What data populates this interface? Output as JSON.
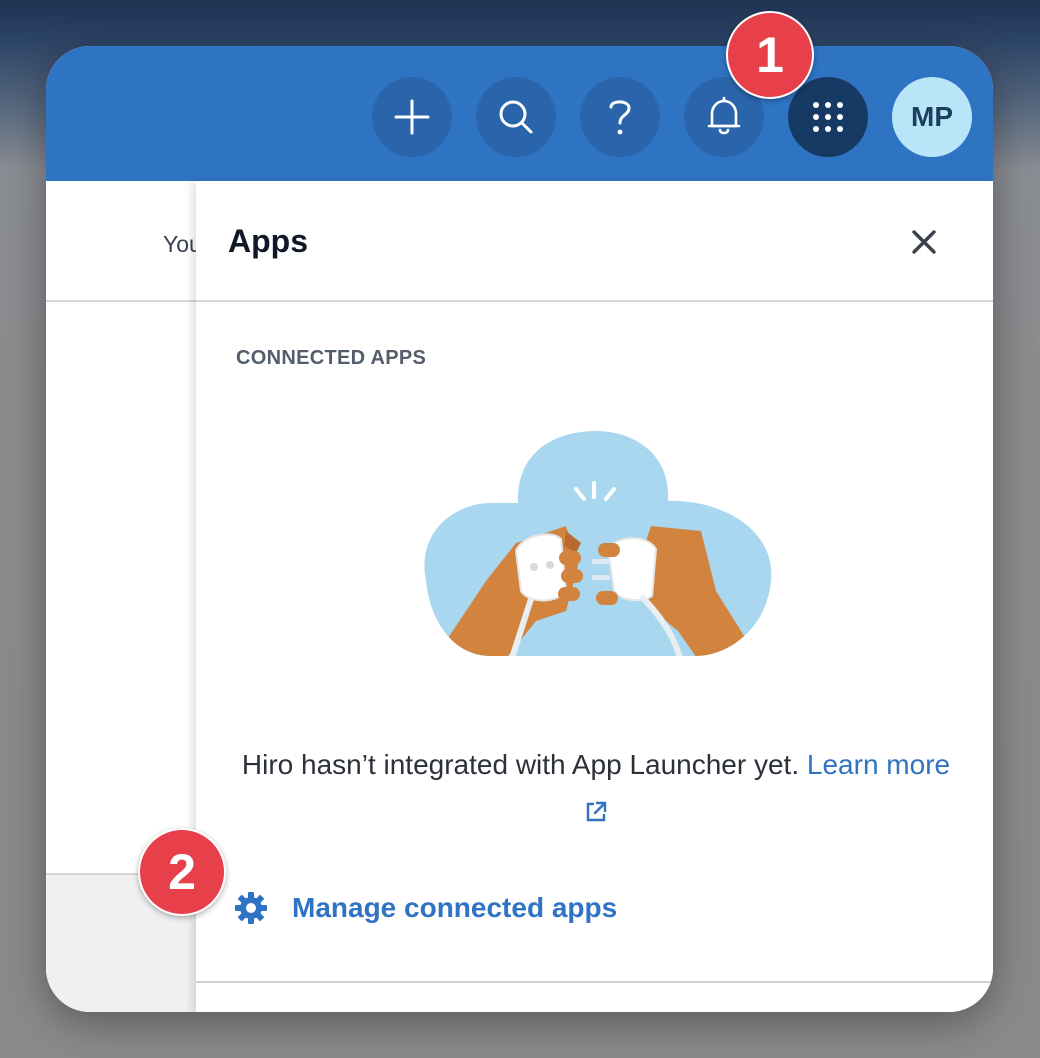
{
  "topbar": {
    "buttons": [
      {
        "icon": "plus-icon"
      },
      {
        "icon": "search-icon"
      },
      {
        "icon": "help-icon"
      },
      {
        "icon": "bell-icon"
      },
      {
        "icon": "app-launcher-grid-icon",
        "active": true
      }
    ],
    "avatar_initials": "MP"
  },
  "background_page": {
    "partial_text": "You"
  },
  "panel": {
    "title": "Apps",
    "section_label": "CONNECTED APPS",
    "message": "Hiro hasn’t integrated with App Launcher yet.",
    "learn_more_link": "Learn more",
    "manage_link": "Manage connected apps"
  },
  "callouts": [
    "1",
    "2"
  ],
  "colors": {
    "topbar": "#2f73c3",
    "button": "#2a65ab",
    "active_button": "#163a63",
    "avatar": "#b8e6f8",
    "link": "#2f73c3",
    "callout": "#e8404b"
  }
}
